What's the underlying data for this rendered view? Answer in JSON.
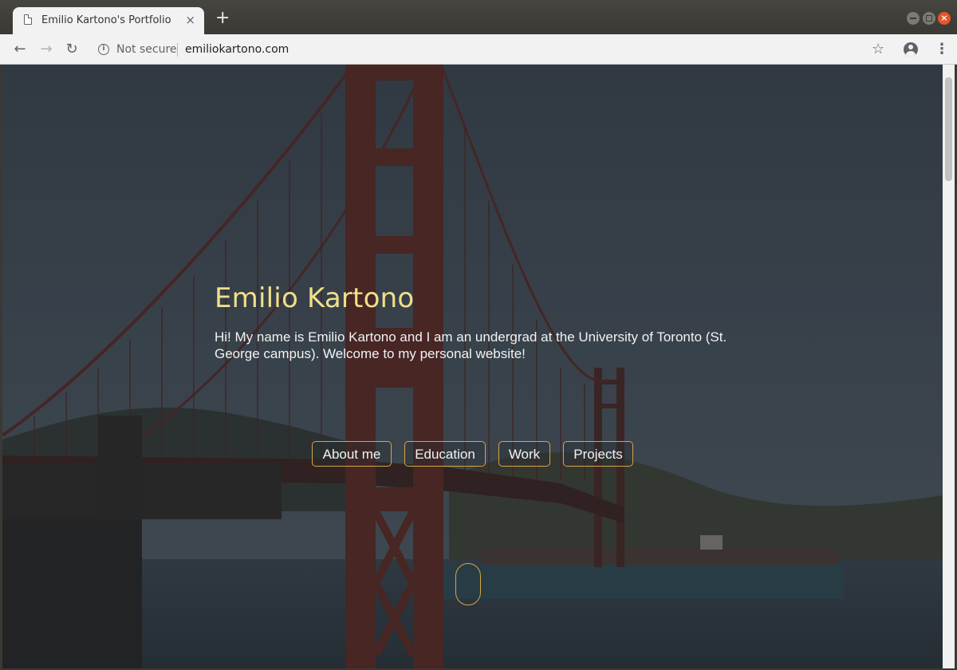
{
  "browser": {
    "tab_title": "Emilio Kartono's Portfolio",
    "tab_close": "×",
    "new_tab": "+",
    "security_label": "Not secure",
    "url": "emiliokartono.com"
  },
  "icons": {
    "back": "←",
    "forward": "→",
    "reload": "↻",
    "info": "i",
    "star": "☆",
    "menu": "⋮",
    "window_close": "×"
  },
  "hero": {
    "name": "Emilio Kartono",
    "intro": "Hi! My name is Emilio Kartono and I am an undergrad at the University of Toronto (St. George campus). Welcome to my personal website!"
  },
  "nav": {
    "about": "About me",
    "education": "Education",
    "work": "Work",
    "projects": "Projects"
  },
  "colors": {
    "accent_border": "#d9a441",
    "name_color": "#f0df8a",
    "bridge_red": "#6b2a25"
  }
}
